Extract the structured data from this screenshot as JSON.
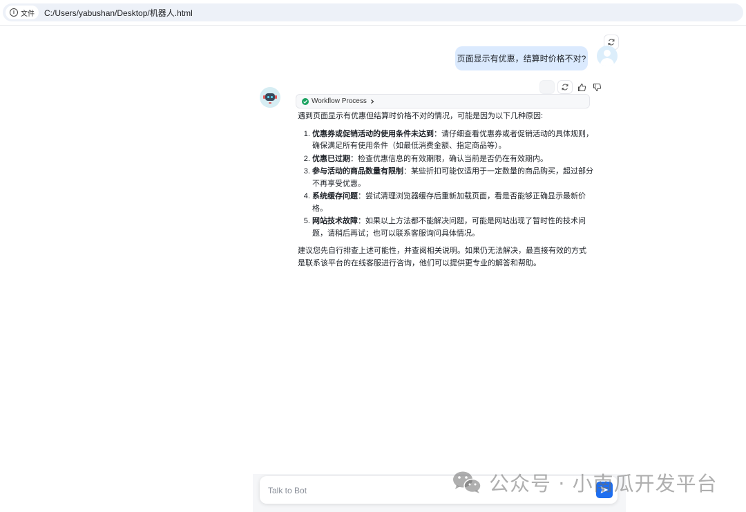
{
  "browser": {
    "site_label": "文件",
    "url": "C:/Users/yabushan/Desktop/机器人.html"
  },
  "user_message": {
    "text": "页面显示有优惠，结算时价格不对?"
  },
  "bot_message": {
    "workflow_label": "Workflow Process",
    "intro": "遇到页面显示有优惠但结算时价格不对的情况，可能是因为以下几种原因:",
    "items": [
      {
        "title": "优惠券或促销活动的使用条件未达到",
        "text": "：请仔细查看优惠券或者促销活动的具体规则，确保满足所有使用条件（如最低消费金额、指定商品等）。"
      },
      {
        "title": "优惠已过期",
        "text": "：检查优惠信息的有效期限，确认当前是否仍在有效期内。"
      },
      {
        "title": "参与活动的商品数量有限制",
        "text": "：某些折扣可能仅适用于一定数量的商品购买，超过部分不再享受优惠。"
      },
      {
        "title": "系统缓存问题",
        "text": "：尝试清理浏览器缓存后重新加载页面，看是否能够正确显示最新价格。"
      },
      {
        "title": "网站技术故障",
        "text": "：如果以上方法都不能解决问题，可能是网站出现了暂时性的技术问题，请稍后再试；也可以联系客服询问具体情况。"
      }
    ],
    "outro": "建议您先自行排查上述可能性，并查阅相关说明。如果仍无法解决，最直接有效的方式是联系该平台的在线客服进行咨询，他们可以提供更专业的解答和帮助。"
  },
  "input": {
    "placeholder": "Talk to Bot"
  },
  "watermark": {
    "text": "公众号 · 小南瓜开发平台"
  },
  "colors": {
    "user_bubble": "#dbeafe",
    "send_button": "#1d6ef0",
    "check": "#1aa260"
  }
}
